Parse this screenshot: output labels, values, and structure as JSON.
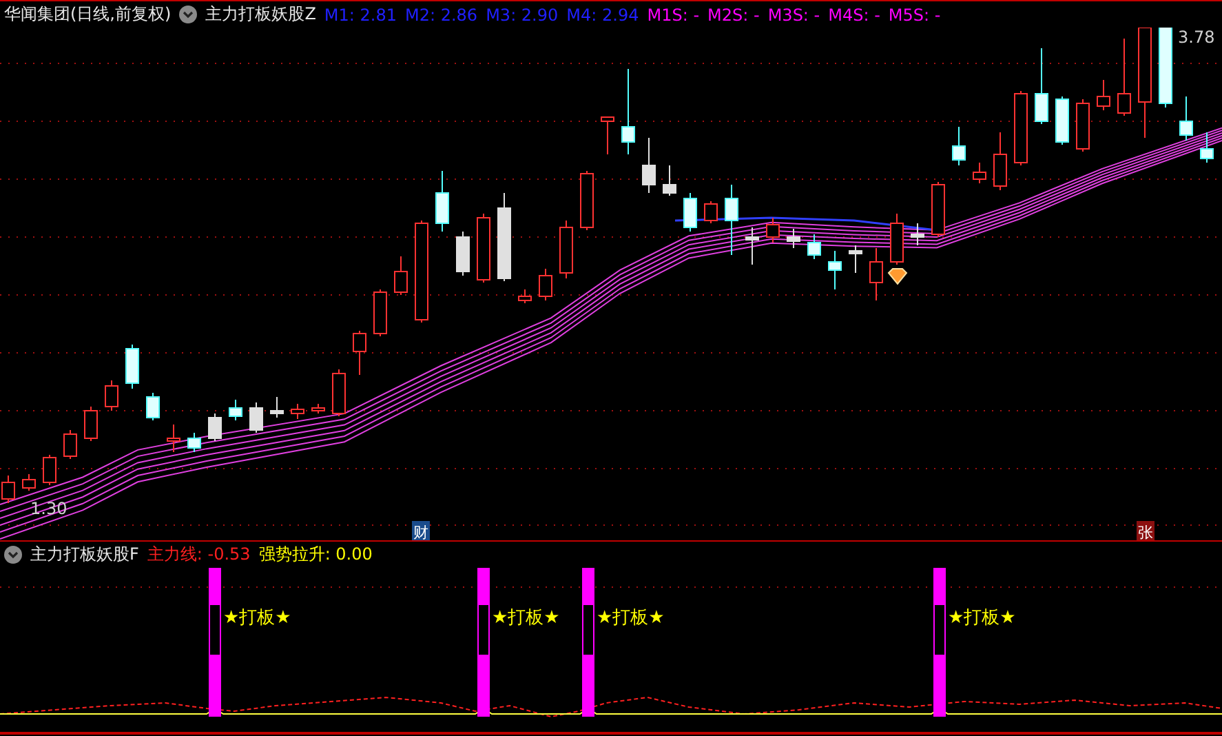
{
  "main_panel": {
    "title": "华闻集团(日线,前复权)",
    "indicator": "主力打板妖股Z",
    "readouts": [
      {
        "text": "M1: 2.81",
        "color": "#2020ff"
      },
      {
        "text": "M2: 2.86",
        "color": "#2020ff"
      },
      {
        "text": "M3: 2.90",
        "color": "#2020ff"
      },
      {
        "text": "M4: 2.94",
        "color": "#2020ff"
      },
      {
        "text": "M1S: -",
        "color": "#ff00ff"
      },
      {
        "text": "M2S: -",
        "color": "#ff00ff"
      },
      {
        "text": "M3S: -",
        "color": "#ff00ff"
      },
      {
        "text": "M4S: -",
        "color": "#ff00ff"
      },
      {
        "text": "M5S: -",
        "color": "#ff00ff"
      }
    ],
    "high_label": "3.78",
    "low_label": "1.30",
    "event_markers": [
      {
        "text": "财",
        "color": "#1a4c8c"
      },
      {
        "text": "张",
        "color": "#8c1010"
      }
    ]
  },
  "sub_panel": {
    "indicator": "主力打板妖股F",
    "readouts": [
      {
        "text": "主力线: -0.53",
        "color": "#ff2020"
      },
      {
        "text": "强势拉升: 0.00",
        "color": "#ffff00"
      }
    ],
    "signals": [
      {
        "label": "★打板★"
      },
      {
        "label": "★打板★"
      },
      {
        "label": "★打板★"
      },
      {
        "label": "★打板★"
      }
    ]
  }
}
